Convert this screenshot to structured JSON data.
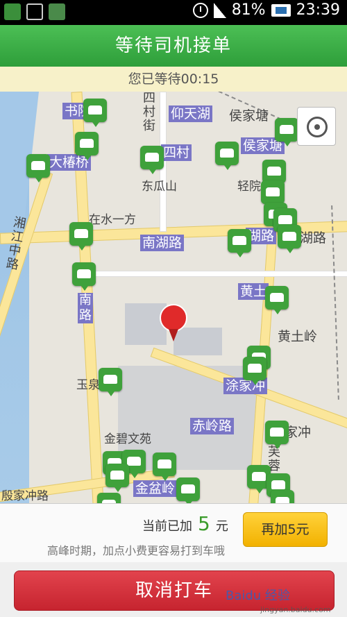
{
  "status_bar": {
    "battery": "81%",
    "time": "23:39"
  },
  "header": {
    "title": "等待司机接单"
  },
  "wait": {
    "text": "您已等待00:15"
  },
  "map": {
    "labels": [
      "书院",
      "仰天湖",
      "侯家塘",
      "大椿桥",
      "四村",
      "侯家塘",
      "东瓜山",
      "轻院",
      "在水一方",
      "南湖路",
      "湖路",
      "湖路",
      "黄土",
      "黄土岭",
      "玉泉",
      "涂家冲",
      "金碧文苑",
      "赤岭路",
      "家冲",
      "金盆岭",
      "殷家冲路"
    ],
    "vertical": [
      "四村街",
      "湘江中路",
      "南路",
      "芙蓉"
    ]
  },
  "tip": {
    "prefix": "当前已加",
    "amount": "5",
    "unit": "元",
    "hint": "高峰时期，加点小费更容易打到车哦",
    "add_button": "再加5元"
  },
  "cancel_button": "取消打车",
  "watermark": {
    "main": "Baidu 经验",
    "sub": "jingyan.baidu.com"
  }
}
